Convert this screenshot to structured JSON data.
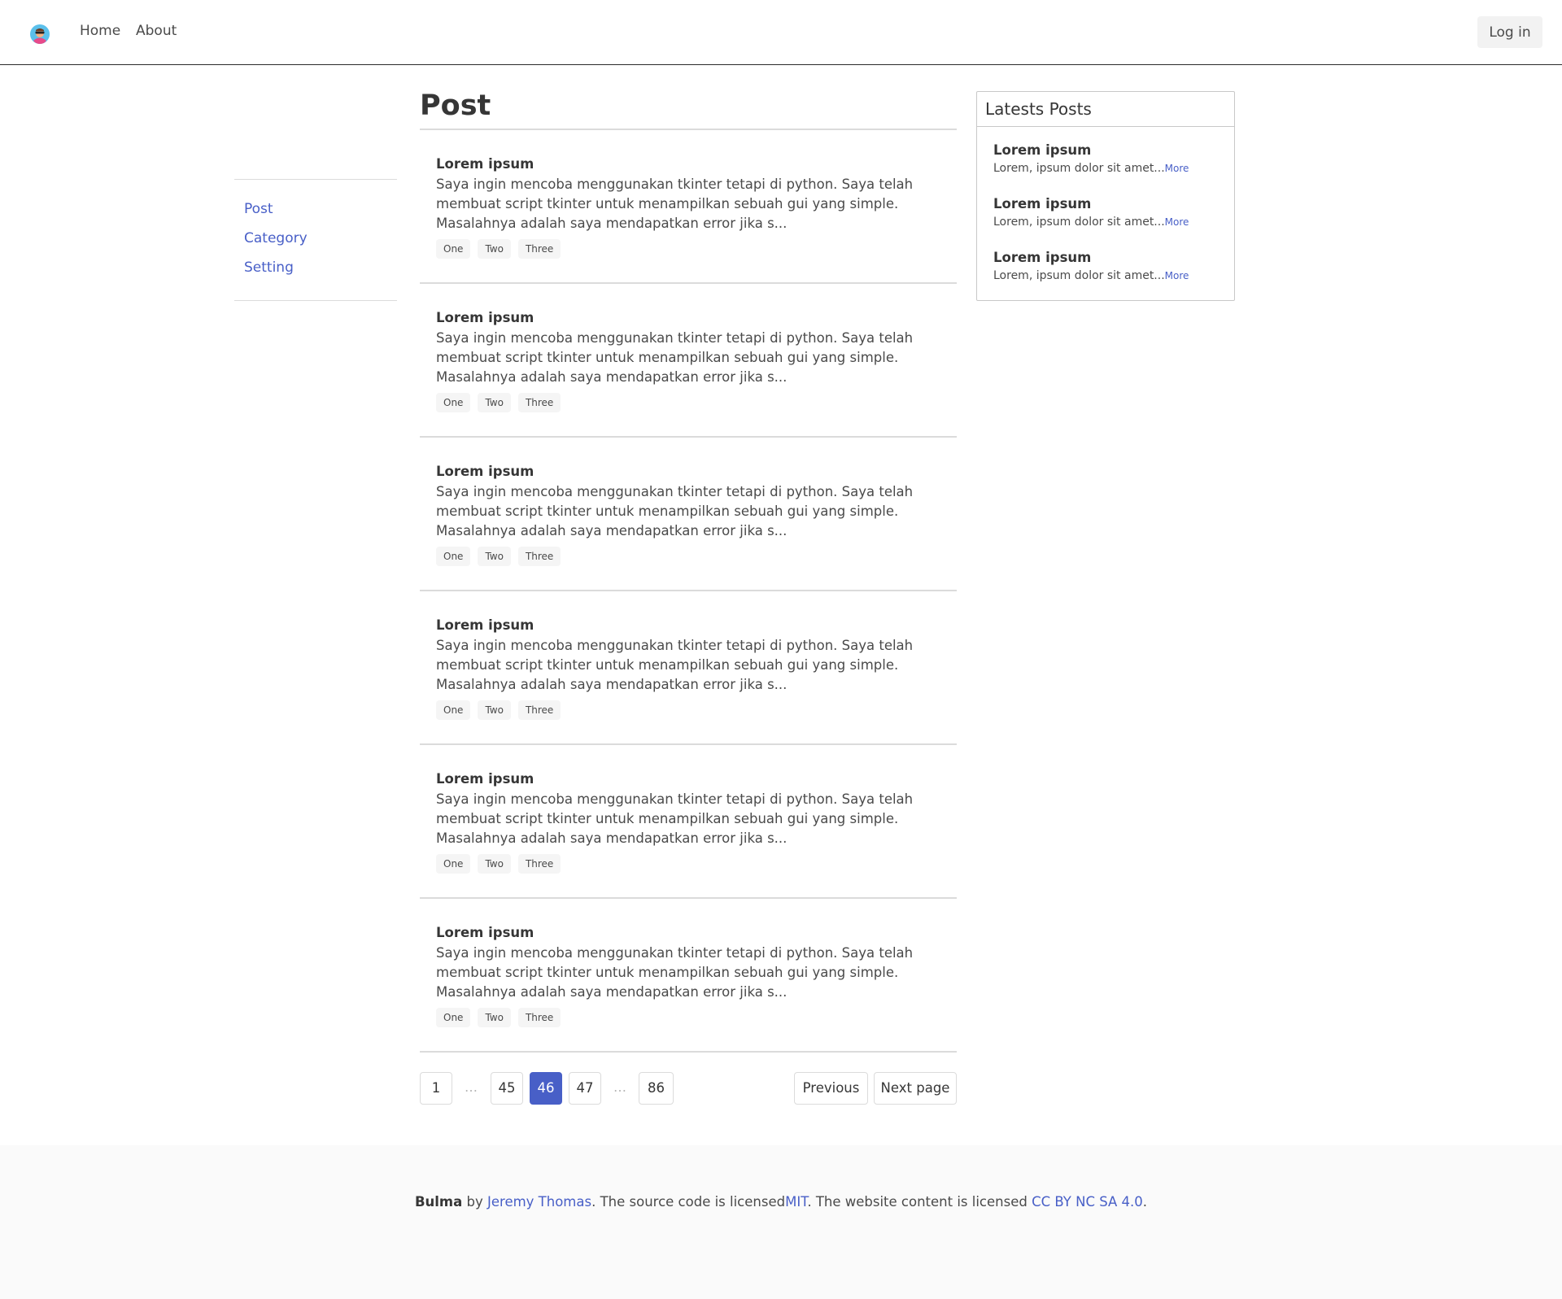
{
  "nav": {
    "logo_icon": "avatar-logo-icon",
    "home": "Home",
    "about": "About",
    "login": "Log in"
  },
  "sidebar": {
    "items": [
      {
        "label": "Post"
      },
      {
        "label": "Category"
      },
      {
        "label": "Setting"
      }
    ]
  },
  "main": {
    "title": "Post",
    "posts": [
      {
        "title": "Lorem ipsum",
        "excerpt": "Saya ingin mencoba menggunakan tkinter tetapi di python. Saya telah membuat script tkinter untuk menampilkan sebuah gui yang simple. Masalahnya adalah saya mendapatkan error jika s...",
        "tags": [
          "One",
          "Two",
          "Three"
        ]
      },
      {
        "title": "Lorem ipsum",
        "excerpt": "Saya ingin mencoba menggunakan tkinter tetapi di python. Saya telah membuat script tkinter untuk menampilkan sebuah gui yang simple. Masalahnya adalah saya mendapatkan error jika s...",
        "tags": [
          "One",
          "Two",
          "Three"
        ]
      },
      {
        "title": "Lorem ipsum",
        "excerpt": "Saya ingin mencoba menggunakan tkinter tetapi di python. Saya telah membuat script tkinter untuk menampilkan sebuah gui yang simple. Masalahnya adalah saya mendapatkan error jika s...",
        "tags": [
          "One",
          "Two",
          "Three"
        ]
      },
      {
        "title": "Lorem ipsum",
        "excerpt": "Saya ingin mencoba menggunakan tkinter tetapi di python. Saya telah membuat script tkinter untuk menampilkan sebuah gui yang simple. Masalahnya adalah saya mendapatkan error jika s...",
        "tags": [
          "One",
          "Two",
          "Three"
        ]
      },
      {
        "title": "Lorem ipsum",
        "excerpt": "Saya ingin mencoba menggunakan tkinter tetapi di python. Saya telah membuat script tkinter untuk menampilkan sebuah gui yang simple. Masalahnya adalah saya mendapatkan error jika s...",
        "tags": [
          "One",
          "Two",
          "Three"
        ]
      },
      {
        "title": "Lorem ipsum",
        "excerpt": "Saya ingin mencoba menggunakan tkinter tetapi di python. Saya telah membuat script tkinter untuk menampilkan sebuah gui yang simple. Masalahnya adalah saya mendapatkan error jika s...",
        "tags": [
          "One",
          "Two",
          "Three"
        ]
      }
    ]
  },
  "pagination": {
    "first": "1",
    "ellipsis": "…",
    "prev_num": "45",
    "current": "46",
    "next_num": "47",
    "last": "86",
    "previous": "Previous",
    "next": "Next page"
  },
  "latest": {
    "heading": "Latests Posts",
    "items": [
      {
        "title": "Lorem ipsum",
        "text": "Lorem, ipsum dolor sit amet...",
        "more": "More"
      },
      {
        "title": "Lorem ipsum",
        "text": "Lorem, ipsum dolor sit amet...",
        "more": "More"
      },
      {
        "title": "Lorem ipsum",
        "text": "Lorem, ipsum dolor sit amet...",
        "more": "More"
      }
    ]
  },
  "footer": {
    "brand": "Bulma",
    "by": " by ",
    "author": "Jeremy Thomas",
    "mid": ". The source code is licensed",
    "license": "MIT",
    "mid2": ". The website content is licensed ",
    "content_license": "CC BY NC SA 4.0",
    "end": "."
  },
  "colors": {
    "accent": "#485fc7",
    "text": "#4a4a4a",
    "heading": "#363636",
    "border": "#dbdbdb"
  }
}
